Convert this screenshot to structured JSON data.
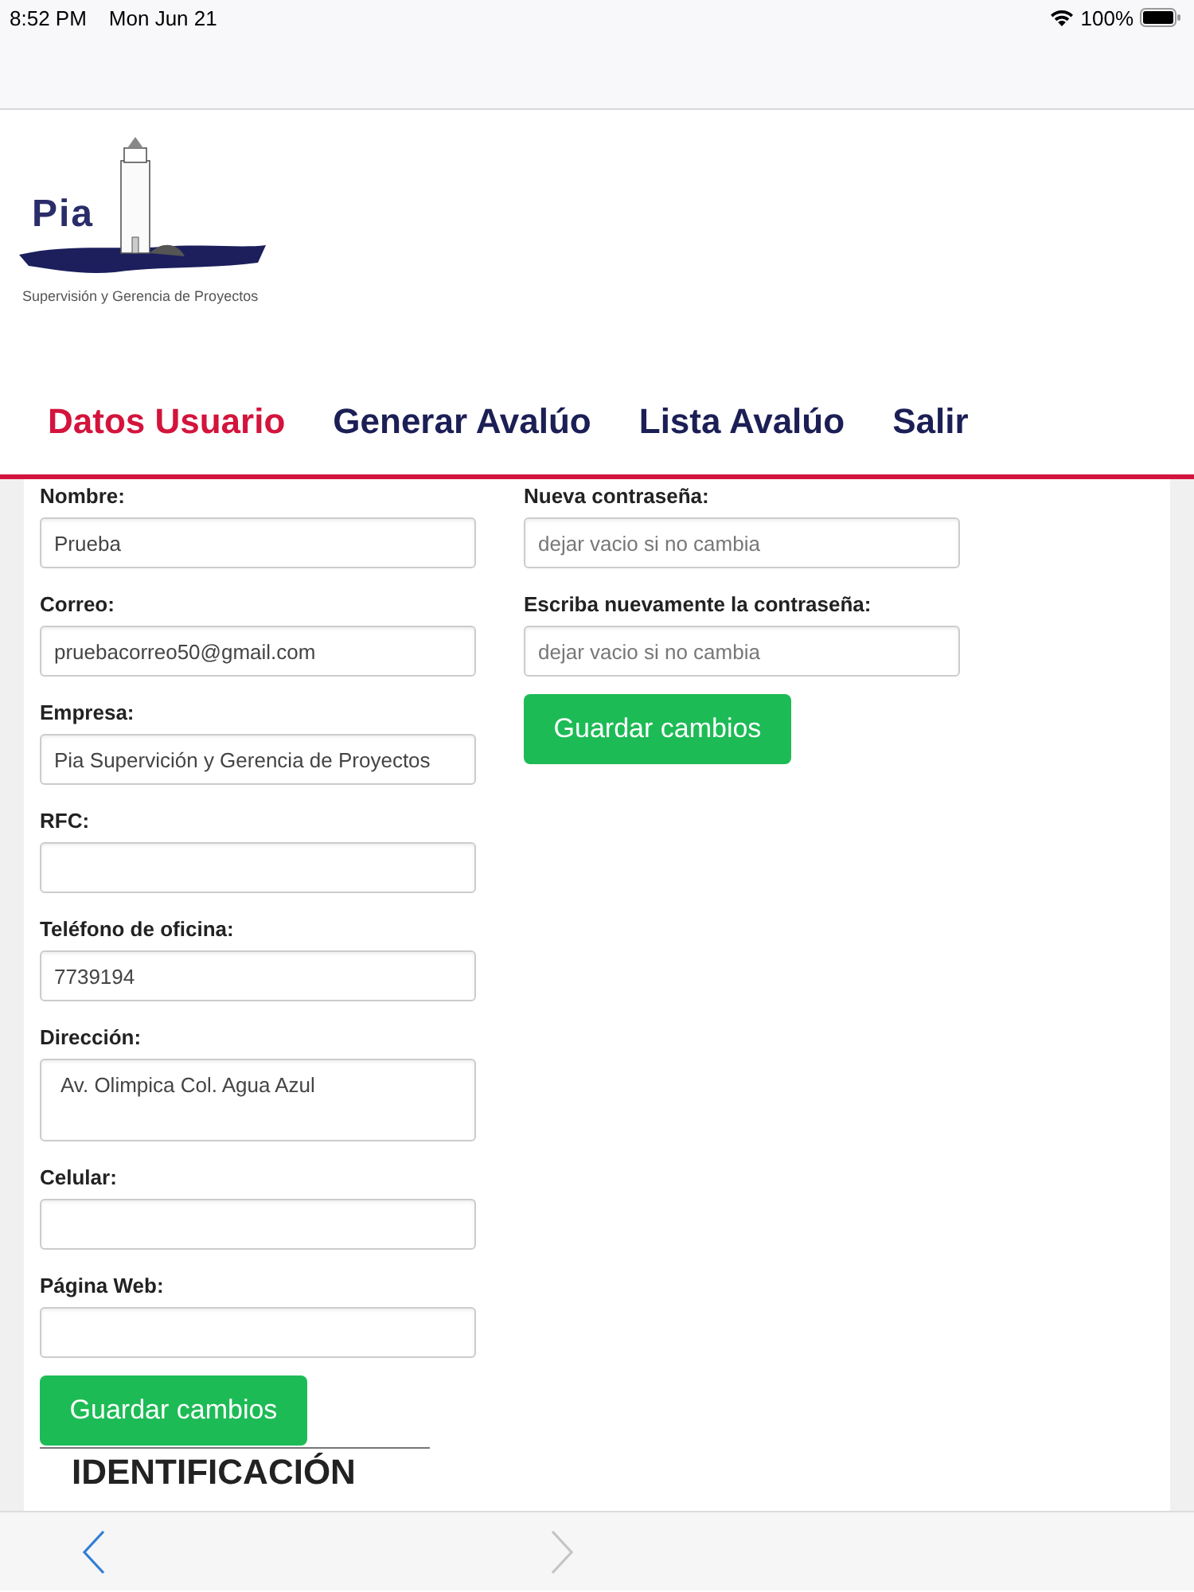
{
  "status_bar": {
    "time": "8:52 PM",
    "date": "Mon Jun 21",
    "battery": "100%"
  },
  "logo": {
    "mark": "Pia",
    "tagline": "Supervisión y Gerencia de Proyectos"
  },
  "nav": [
    {
      "label": "Datos Usuario",
      "selected": true
    },
    {
      "label": "Generar Avalúo",
      "selected": false
    },
    {
      "label": "Lista Avalúo",
      "selected": false
    },
    {
      "label": "Salir",
      "selected": false
    }
  ],
  "form_left": {
    "fields": [
      {
        "label": "Nombre:",
        "kind": "input",
        "value": "Prueba"
      },
      {
        "label": "Correo:",
        "kind": "input",
        "value": "pruebacorreo50@gmail.com"
      },
      {
        "label": "Empresa:",
        "kind": "input",
        "value": "Pia Supervición y Gerencia de Proyectos"
      },
      {
        "label": "RFC:",
        "kind": "input"
      },
      {
        "label": "Teléfono de oficina:",
        "kind": "input",
        "value": "7739194"
      },
      {
        "label": "Dirección:",
        "kind": "textarea",
        "value": "Av. Olimpica Col. Agua Azul"
      },
      {
        "label": "Celular:",
        "kind": "input"
      },
      {
        "label": "Página Web:",
        "kind": "input"
      }
    ],
    "button": "Guardar cambios"
  },
  "form_right": {
    "fields": [
      {
        "label": "Nueva contraseña:",
        "kind": "input",
        "placeholder": "dejar vacio si no cambia"
      },
      {
        "label": "Escriba nuevamente la contraseña:",
        "kind": "input",
        "placeholder": "dejar vacio si no cambia"
      }
    ],
    "button": "Guardar cambios"
  },
  "section_heading": "IDENTIFICACIÓN",
  "browser_toolbar": {
    "back": {
      "disabled": false
    },
    "forward": {
      "disabled": true
    }
  }
}
